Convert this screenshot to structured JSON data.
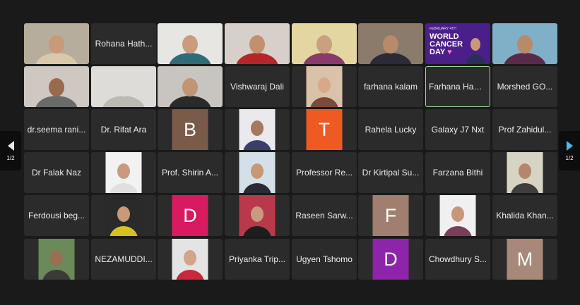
{
  "colors": {
    "background": "#1a1a1a",
    "tile": "#2b2b2b",
    "active_border": "#9fdc9f"
  },
  "navigation": {
    "prev_page": "1/2",
    "next_page": "1/2"
  },
  "rows": [
    [
      {
        "type": "photo",
        "name": "participant-video",
        "tone": "#b7ad9c",
        "skin": "#c89a78",
        "cloth": "#d9c9a8"
      },
      {
        "type": "name",
        "name": "Rohana Hath..."
      },
      {
        "type": "photo",
        "name": "participant-video",
        "tone": "#e8e6e2",
        "skin": "#c99c80",
        "cloth": "#2e6c78"
      },
      {
        "type": "photo",
        "name": "participant-video",
        "tone": "#d7cfca",
        "skin": "#c09070",
        "cloth": "#b5252a"
      },
      {
        "type": "photo",
        "name": "participant-video",
        "tone": "#e4d6a0",
        "skin": "#c9a080",
        "cloth": "#8a3a6a"
      },
      {
        "type": "photo",
        "name": "participant-video",
        "tone": "#8a7b6a",
        "skin": "#b88a6a",
        "cloth": "#2a2a38"
      },
      {
        "type": "banner",
        "name": "World Cancer Day",
        "small": "FEBRUARY 4TH",
        "line1": "WORLD",
        "line2": "CANCER",
        "line3": "DAY",
        "bg": "#4b1f8a"
      },
      {
        "type": "photo",
        "name": "participant-video",
        "tone": "#7fb0c8",
        "skin": "#b88a6a",
        "cloth": "#5a2a4a"
      }
    ],
    [
      {
        "type": "photo",
        "name": "participant-video",
        "tone": "#cfc8c2",
        "skin": "#9a6a4e",
        "cloth": "#6a6a6a"
      },
      {
        "type": "photo",
        "name": "participant-video",
        "tone": "#dedcd8",
        "skin": "#dedcd8",
        "cloth": "#bdbab4"
      },
      {
        "type": "photo",
        "name": "participant-video",
        "tone": "#c8c4bf",
        "skin": "#c09474",
        "cloth": "#2a2a2a"
      },
      {
        "type": "name",
        "name": "Vishwaraj Dali"
      },
      {
        "type": "narrow",
        "name": "participant-photo",
        "tone": "#d9c2a8",
        "skin": "#d8a88a",
        "cloth": "#7c4a3a"
      },
      {
        "type": "name",
        "name": "farhana kalam"
      },
      {
        "type": "name",
        "name": "Farhana Haque",
        "active": true
      },
      {
        "type": "name",
        "name": "Morshed GO..."
      }
    ],
    [
      {
        "type": "name",
        "name": "dr.seema rani..."
      },
      {
        "type": "name",
        "name": "Dr. Rifat Ara"
      },
      {
        "type": "avatar",
        "letter": "B",
        "color": "#7a5a48"
      },
      {
        "type": "narrow",
        "name": "participant-photo",
        "tone": "#e9e9ee",
        "skin": "#a6785e",
        "cloth": "#3a3f6a"
      },
      {
        "type": "avatar",
        "letter": "T",
        "color": "#ef5a22"
      },
      {
        "type": "name",
        "name": "Rahela Lucky"
      },
      {
        "type": "name",
        "name": "Galaxy J7 Nxt"
      },
      {
        "type": "name",
        "name": "Prof Zahidul..."
      }
    ],
    [
      {
        "type": "name",
        "name": "Dr Falak Naz"
      },
      {
        "type": "narrow",
        "name": "participant-photo",
        "tone": "#f2f2f2",
        "skin": "#c89a80",
        "cloth": "#e0dede"
      },
      {
        "type": "name",
        "name": "Prof. Shirin A..."
      },
      {
        "type": "narrow",
        "name": "participant-photo",
        "tone": "#d4e0e8",
        "skin": "#c69878",
        "cloth": "#2a2a32"
      },
      {
        "type": "name",
        "name": "Professor Re..."
      },
      {
        "type": "name",
        "name": "Dr Kirtipal Su..."
      },
      {
        "type": "name",
        "name": "Farzana Bithi"
      },
      {
        "type": "narrow",
        "name": "participant-photo",
        "tone": "#d8d4c4",
        "skin": "#b6866a",
        "cloth": "#3e3e3e"
      }
    ],
    [
      {
        "type": "name",
        "name": "Ferdousi beg..."
      },
      {
        "type": "narrow",
        "name": "participant-photo",
        "tone": "#2a2a2a",
        "skin": "#c89a78",
        "cloth": "#d8c020"
      },
      {
        "type": "avatar",
        "letter": "D",
        "color": "#d81b60"
      },
      {
        "type": "narrow",
        "name": "participant-photo",
        "tone": "#b83a4a",
        "skin": "#c89a80",
        "cloth": "#1e1e1e"
      },
      {
        "type": "name",
        "name": "Raseen Sarw..."
      },
      {
        "type": "avatar",
        "letter": "F",
        "color": "#a07f70"
      },
      {
        "type": "narrow",
        "name": "participant-photo",
        "tone": "#f0f0f0",
        "skin": "#c8977a",
        "cloth": "#7a3e5a"
      },
      {
        "type": "name",
        "name": "Khalida Khan..."
      }
    ],
    [
      {
        "type": "narrow",
        "name": "participant-photo",
        "tone": "#6a8a5a",
        "skin": "#9a6e52",
        "cloth": "#3a3a3a"
      },
      {
        "type": "name",
        "name": "NEZAMUDDI..."
      },
      {
        "type": "narrow",
        "name": "participant-photo",
        "tone": "#e4e4e4",
        "skin": "#d2a48a",
        "cloth": "#c8283a"
      },
      {
        "type": "name",
        "name": "Priyanka Trip..."
      },
      {
        "type": "name",
        "name": "Ugyen Tshomo"
      },
      {
        "type": "avatar",
        "letter": "D",
        "color": "#8e24aa"
      },
      {
        "type": "name",
        "name": "Chowdhury S..."
      },
      {
        "type": "avatar",
        "letter": "M",
        "color": "#a88878"
      }
    ]
  ]
}
